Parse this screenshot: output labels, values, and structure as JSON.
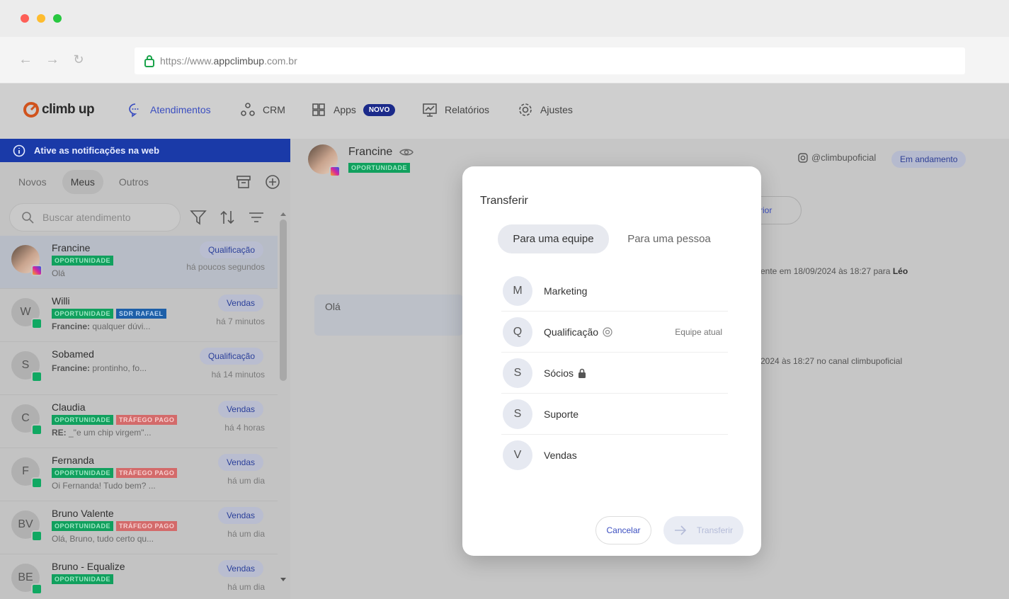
{
  "browser": {
    "url_prefix": "https://www.",
    "url_domain": "appclimbup",
    "url_suffix": ".com.br",
    "colors": {
      "close": "#fe5f57",
      "minimize": "#febc2e",
      "maximize": "#28c840"
    }
  },
  "app": {
    "logo_text": "climb up",
    "nav": [
      {
        "label": "Atendimentos",
        "icon": "chat-icon"
      },
      {
        "label": "CRM",
        "icon": "crm-nodes-icon"
      },
      {
        "label": "Apps",
        "icon": "apps-grid-icon",
        "badge": "NOVO"
      },
      {
        "label": "Relatórios",
        "icon": "report-chart-icon"
      },
      {
        "label": "Ajustes",
        "icon": "gear-icon"
      }
    ]
  },
  "sidebar": {
    "notice": "Ative as notificações na web",
    "tabs": [
      "Novos",
      "Meus",
      "Outros"
    ],
    "active_tab": "Meus",
    "search_placeholder": "Buscar atendimento",
    "conversations": [
      {
        "name": "Francine",
        "initials": "",
        "channel": "instagram",
        "tags": [
          {
            "text": "OPORTUNIDADE",
            "color": "g"
          }
        ],
        "sender": "",
        "message": "Olá",
        "stage": "Qualificação",
        "time": "há poucos segundos",
        "selected": true
      },
      {
        "name": "Willi",
        "initials": "W",
        "channel": "whatsapp",
        "tags": [
          {
            "text": "OPORTUNIDADE",
            "color": "g"
          },
          {
            "text": "SDR RAFAEL",
            "color": "b"
          }
        ],
        "sender": "Francine:",
        "message": " qualquer dúvi...",
        "stage": "Vendas",
        "time": "há 7 minutos"
      },
      {
        "name": "Sobamed",
        "initials": "S",
        "channel": "whatsapp",
        "tags": [],
        "sender": "Francine:",
        "message": " prontinho, fo...",
        "stage": "Qualificação",
        "time": "há 14 minutos"
      },
      {
        "name": "Claudia",
        "initials": "C",
        "channel": "whatsapp",
        "tags": [
          {
            "text": "OPORTUNIDADE",
            "color": "g"
          },
          {
            "text": "TRÁFEGO PAGO",
            "color": "r"
          }
        ],
        "sender": "RE:",
        "message": " _\"e um chip virgem\"...",
        "stage": "Vendas",
        "time": "há 4 horas"
      },
      {
        "name": "Fernanda",
        "initials": "F",
        "channel": "whatsapp",
        "tags": [
          {
            "text": "OPORTUNIDADE",
            "color": "g"
          },
          {
            "text": "TRÁFEGO PAGO",
            "color": "r"
          }
        ],
        "sender": "",
        "message": "Oi Fernanda! Tudo bem? ...",
        "stage": "Vendas",
        "time": "há um dia"
      },
      {
        "name": "Bruno Valente",
        "initials": "BV",
        "channel": "whatsapp",
        "tags": [
          {
            "text": "OPORTUNIDADE",
            "color": "g"
          },
          {
            "text": "TRÁFEGO PAGO",
            "color": "r"
          }
        ],
        "sender": "",
        "message": "Olá, Bruno, tudo certo qu...",
        "stage": "Vendas",
        "time": "há um dia"
      },
      {
        "name": "Bruno - Equalize",
        "initials": "BE",
        "channel": "whatsapp",
        "tags": [
          {
            "text": "OPORTUNIDADE",
            "color": "g"
          }
        ],
        "sender": "",
        "message": "",
        "stage": "Vendas",
        "time": "há um dia"
      }
    ]
  },
  "main": {
    "contact_name": "Francine",
    "contact_tag": "OPORTUNIDADE",
    "instagram_handle": "@climbupoficial",
    "status": "Em andamento",
    "partial_button": "rior",
    "log_line_1_prefix": "ente em 18/09/2024 às 18:27 para ",
    "log_line_1_name": "Léo",
    "log_line_2": "2024 às 18:27 no canal climbupoficial",
    "message_bubble": "Olá"
  },
  "modal": {
    "title": "Transferir",
    "segments": [
      "Para uma equipe",
      "Para uma pessoa"
    ],
    "teams": [
      {
        "initial": "M",
        "name": "Marketing",
        "note": ""
      },
      {
        "initial": "Q",
        "name": "Qualificação",
        "note": "Equipe atual",
        "icon": "target-icon"
      },
      {
        "initial": "S",
        "name": "Sócios",
        "note": "",
        "icon": "lock-icon"
      },
      {
        "initial": "S",
        "name": "Suporte",
        "note": ""
      },
      {
        "initial": "V",
        "name": "Vendas",
        "note": ""
      }
    ],
    "cancel_label": "Cancelar",
    "transfer_label": "Transferir"
  }
}
